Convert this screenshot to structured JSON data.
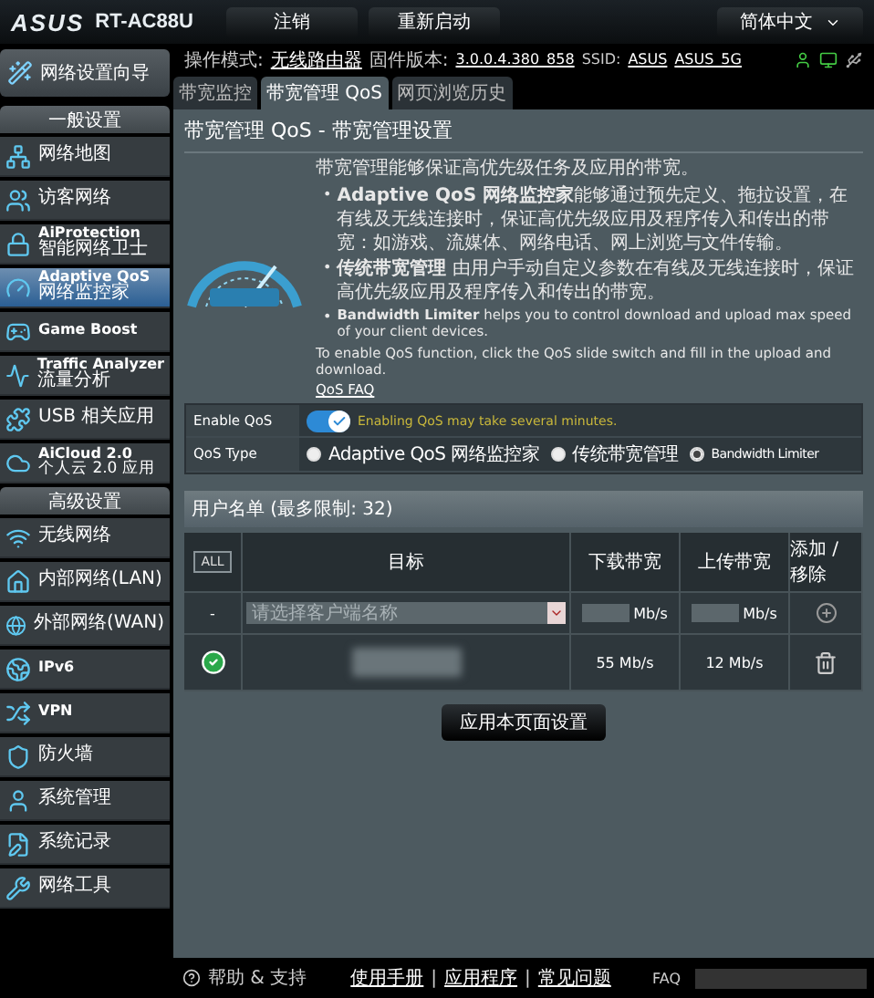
{
  "header": {
    "logo": "ASUS",
    "model": "RT-AC88U",
    "buttons": [
      "注销",
      "重新启动"
    ],
    "language": "简体中文"
  },
  "info_bar": {
    "mode_label": "操作模式:",
    "mode": "无线路由器",
    "firmware_label": "固件版本:",
    "firmware": "3.0.0.4.380_858",
    "ssid_label": "SSID:",
    "ssids": [
      "ASUS",
      "ASUS_5G"
    ]
  },
  "sidebar": {
    "wizard": "网络设置向导",
    "sections": [
      {
        "title": "一般设置",
        "items": [
          {
            "label": "网络地图",
            "selected": false
          },
          {
            "label": "访客网络",
            "selected": false
          },
          {
            "label": "AiProtection",
            "sublabel": "智能网络卫士",
            "selected": false
          },
          {
            "label": "Adaptive QoS",
            "sublabel": "网络监控家",
            "selected": true
          },
          {
            "label": "Game Boost",
            "selected": false
          },
          {
            "label": "Traffic Analyzer",
            "sublabel": "流量分析",
            "selected": false
          },
          {
            "label": "USB 相关应用",
            "selected": false
          },
          {
            "label": "AiCloud 2.0",
            "sublabel": "个人云 2.0 应用",
            "selected": false
          }
        ]
      },
      {
        "title": "高级设置",
        "items": [
          {
            "label": "无线网络",
            "selected": false
          },
          {
            "label": "内部网络(LAN)",
            "selected": false
          },
          {
            "label": "外部网络(WAN)",
            "selected": false
          },
          {
            "label": "IPv6",
            "selected": false
          },
          {
            "label": "VPN",
            "selected": false
          },
          {
            "label": "防火墙",
            "selected": false
          },
          {
            "label": "系统管理",
            "selected": false
          },
          {
            "label": "系统记录",
            "selected": false
          },
          {
            "label": "网络工具",
            "selected": false
          }
        ]
      }
    ]
  },
  "tabs": [
    {
      "label": "带宽监控",
      "selected": false
    },
    {
      "label": "带宽管理 QoS",
      "selected": true
    },
    {
      "label": "网页浏览历史",
      "selected": false
    }
  ],
  "page": {
    "title": "带宽管理 QoS - 带宽管理设置",
    "intro": "带宽管理能够保证高优先级任务及应用的带宽。",
    "bullets": [
      {
        "marker": "•",
        "text": "**Adaptive QoS 网络监控家**能够通过预先定义、拖拉设置，在有线及无线连接时，保证高优先级应用及程序传入和传出的带宽：如游戏、流媒体、网络电话、网上浏览与文件传输。"
      },
      {
        "marker": "•",
        "text": "**传统带宽管理** 由用户手动自定义参数在有线及无线连接时，保证高优先级应用及程序传入和传出的带宽。"
      },
      {
        "marker": "•",
        "text": "**Bandwidth Limiter** helps you to control download and upload max speed of your client devices."
      }
    ],
    "note": "To enable QoS function, click the QoS slide switch and fill in the upload and download.",
    "faq_link": "QoS FAQ"
  },
  "settings": [
    {
      "label": "Enable QoS",
      "kind": "toggle",
      "on": true,
      "hint": "Enabling QoS may take several minutes."
    },
    {
      "label": "QoS Type",
      "kind": "radio",
      "options": [
        {
          "label": "Adaptive QoS 网络监控家",
          "selected": false
        },
        {
          "label": "传统带宽管理",
          "selected": false
        },
        {
          "label": "Bandwidth Limiter",
          "selected": true
        }
      ]
    }
  ],
  "client_list": {
    "title": "用户名单 (最多限制: 32)",
    "all_button": "ALL",
    "columns": [
      "目标",
      "下载带宽",
      "上传带宽",
      "添加 / 移除"
    ],
    "new_row": {
      "marker": "-",
      "placeholder": "请选择客户端名称",
      "download_unit": "Mb/s",
      "upload_unit": "Mb/s"
    },
    "rows": [
      {
        "enabled": true,
        "download": "55 Mb/s",
        "upload": "12 Mb/s"
      }
    ]
  },
  "apply_button": "应用本页面设置",
  "footer": {
    "help": "帮助 & 支持",
    "links": [
      "使用手册",
      "应用程序",
      "常见问题"
    ],
    "separator": "|",
    "faq": "FAQ"
  }
}
